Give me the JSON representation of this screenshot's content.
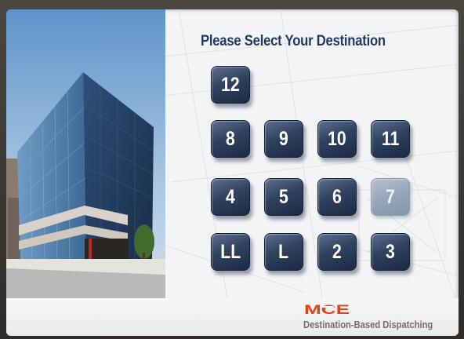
{
  "title": "Please Select Your Destination",
  "floors": {
    "f12": "12",
    "f8": "8",
    "f9": "9",
    "f10": "10",
    "f11": "11",
    "f4": "4",
    "f5": "5",
    "f6": "6",
    "f7": "7",
    "fLL": "LL",
    "fL": "L",
    "f2": "2",
    "f3": "3"
  },
  "floor_states": {
    "f7": "unavailable"
  },
  "brand": {
    "logo_text": "MCE",
    "tagline": "Destination-Based Dispatching",
    "logo_color": "#e0421b"
  },
  "colors": {
    "button_dark": "#2f4260",
    "title": "#1f3a5f"
  }
}
